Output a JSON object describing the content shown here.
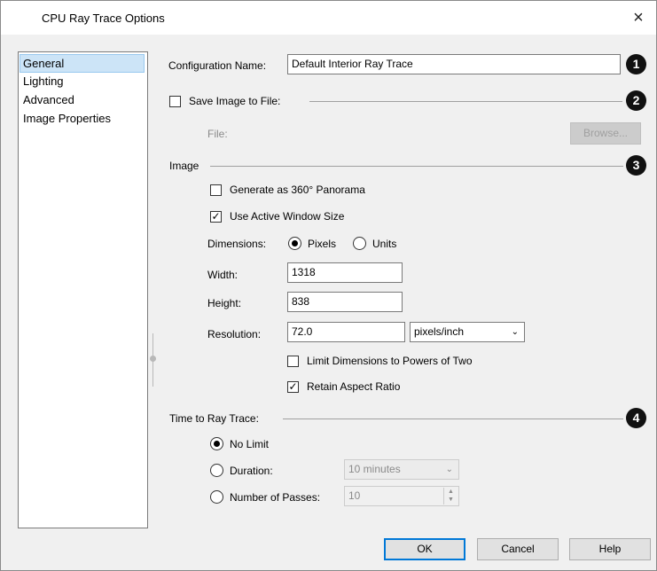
{
  "window": {
    "title": "CPU Ray Trace Options",
    "close_glyph": "×"
  },
  "sidebar": {
    "items": [
      {
        "label": "General",
        "selected": true
      },
      {
        "label": "Lighting",
        "selected": false
      },
      {
        "label": "Advanced",
        "selected": false
      },
      {
        "label": "Image Properties",
        "selected": false
      }
    ]
  },
  "config": {
    "label": "Configuration Name:",
    "value": "Default Interior Ray Trace",
    "badge": "1"
  },
  "save": {
    "label": "Save Image to File:",
    "checked": false,
    "badge": "2",
    "file_label": "File:",
    "browse_label": "Browse..."
  },
  "image": {
    "heading": "Image",
    "badge": "3",
    "panorama_label": "Generate as 360° Panorama",
    "panorama_checked": false,
    "active_window_label": "Use Active Window Size",
    "active_window_checked": true,
    "dimensions_label": "Dimensions:",
    "pixels_label": "Pixels",
    "units_label": "Units",
    "dimensions_selected": "Pixels",
    "width_label": "Width:",
    "width_value": "1318",
    "height_label": "Height:",
    "height_value": "838",
    "resolution_label": "Resolution:",
    "resolution_value": "72.0",
    "resolution_unit": "pixels/inch",
    "powers_label": "Limit Dimensions to Powers of Two",
    "powers_checked": false,
    "aspect_label": "Retain Aspect Ratio",
    "aspect_checked": true
  },
  "time": {
    "heading": "Time to Ray Trace:",
    "badge": "4",
    "no_limit_label": "No Limit",
    "duration_label": "Duration:",
    "duration_value": "10 minutes",
    "passes_label": "Number of Passes:",
    "passes_value": "10",
    "selected": "No Limit"
  },
  "buttons": {
    "ok": "OK",
    "cancel": "Cancel",
    "help": "Help"
  },
  "colors": {
    "accent": "#0078d7",
    "selection": "#cce4f7",
    "dialog_bg": "#f0f0f0"
  }
}
